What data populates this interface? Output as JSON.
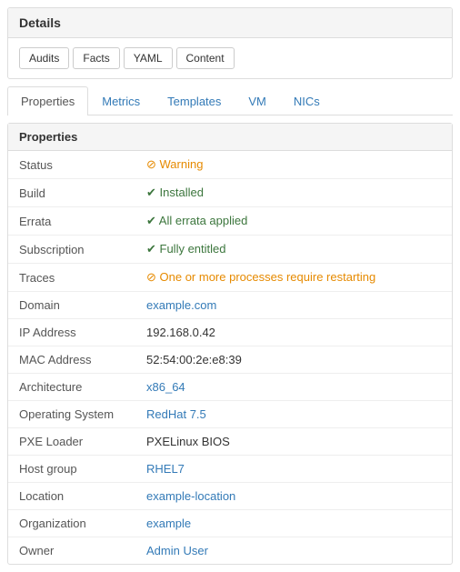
{
  "panel": {
    "title": "Details"
  },
  "toolbar": {
    "buttons": [
      {
        "label": "Audits",
        "name": "audits-button"
      },
      {
        "label": "Facts",
        "name": "facts-button"
      },
      {
        "label": "YAML",
        "name": "yaml-button"
      },
      {
        "label": "Content",
        "name": "content-button"
      }
    ]
  },
  "tabs": [
    {
      "label": "Properties",
      "name": "tab-properties",
      "active": true
    },
    {
      "label": "Metrics",
      "name": "tab-metrics",
      "active": false
    },
    {
      "label": "Templates",
      "name": "tab-templates",
      "active": false
    },
    {
      "label": "VM",
      "name": "tab-vm",
      "active": false
    },
    {
      "label": "NICs",
      "name": "tab-nics",
      "active": false
    }
  ],
  "properties": {
    "heading": "Properties",
    "rows": [
      {
        "key": "Status",
        "value": "Warning",
        "type": "warning",
        "href": null
      },
      {
        "key": "Build",
        "value": "Installed",
        "type": "ok",
        "href": null
      },
      {
        "key": "Errata",
        "value": "All errata applied",
        "type": "ok",
        "href": null
      },
      {
        "key": "Subscription",
        "value": "Fully entitled",
        "prefix": "0 ",
        "type": "ok",
        "href": null
      },
      {
        "key": "Traces",
        "value": "One or more processes require restarting",
        "type": "warning",
        "href": null
      },
      {
        "key": "Domain",
        "value": "example.com",
        "type": "link",
        "href": "#"
      },
      {
        "key": "IP Address",
        "value": "192.168.0.42",
        "type": "plain",
        "href": null
      },
      {
        "key": "MAC Address",
        "value": "52:54:00:2e:e8:39",
        "type": "plain",
        "href": null
      },
      {
        "key": "Architecture",
        "value": "x86_64",
        "type": "link",
        "href": "#"
      },
      {
        "key": "Operating System",
        "value": "RedHat 7.5",
        "type": "link",
        "href": "#"
      },
      {
        "key": "PXE Loader",
        "value": "PXELinux BIOS",
        "type": "plain",
        "href": null
      },
      {
        "key": "Host group",
        "value": "RHEL7",
        "type": "link",
        "href": "#"
      },
      {
        "key": "Location",
        "value": "example-location",
        "type": "link",
        "href": "#"
      },
      {
        "key": "Organization",
        "value": "example",
        "type": "link",
        "href": "#"
      },
      {
        "key": "Owner",
        "value": "Admin User",
        "type": "link",
        "href": "#"
      }
    ]
  }
}
